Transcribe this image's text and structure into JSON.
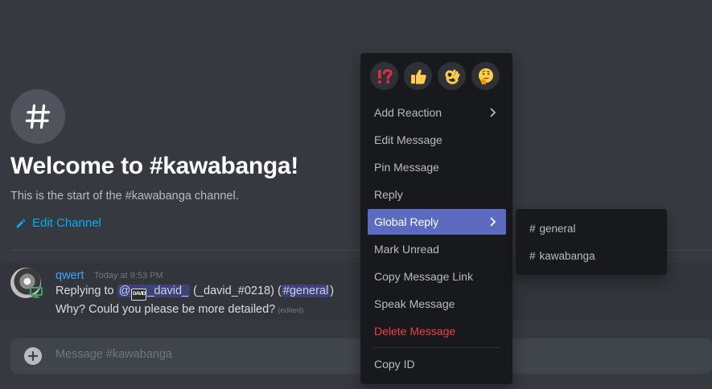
{
  "channel_header": {
    "welcome_title": "Welcome to #kawabanga!",
    "welcome_subtitle": "This is the start of the #kawabanga channel.",
    "edit_channel_label": "Edit Channel"
  },
  "message": {
    "author": "qwert",
    "timestamp": "Today at 9:53 PM",
    "reply_prefix": "Replying to",
    "reply_mention_at": "@",
    "reply_mention_badge": "DAVID",
    "reply_mention_name": "_david_",
    "reply_tag": "(_david_#0218)",
    "reply_channel": "#general",
    "text": "Why? Could you please be more detailed?",
    "edited_label": "(edited)",
    "avatar_status_icon": "desktop-icon"
  },
  "composer": {
    "placeholder": "Message #kawabanga"
  },
  "context_menu": {
    "reactions": [
      {
        "name": "exclamation-question-emoji",
        "glyph": "⁉"
      },
      {
        "name": "thumbs-up-emoji",
        "glyph": "👍"
      },
      {
        "name": "ok-hand-emoji",
        "glyph": "👌"
      },
      {
        "name": "thinking-emoji",
        "glyph": "🤔"
      }
    ],
    "items": [
      {
        "label": "Add Reaction",
        "submenu": true
      },
      {
        "label": "Edit Message"
      },
      {
        "label": "Pin Message"
      },
      {
        "label": "Reply"
      },
      {
        "label": "Global Reply",
        "submenu": true,
        "active": true
      },
      {
        "label": "Mark Unread"
      },
      {
        "label": "Copy Message Link"
      },
      {
        "label": "Speak Message"
      },
      {
        "label": "Delete Message",
        "danger": true
      },
      {
        "label": "Copy ID"
      }
    ]
  },
  "global_reply_submenu": {
    "items": [
      {
        "hash": "#",
        "label": "general"
      },
      {
        "hash": "#",
        "label": "kawabanga"
      }
    ]
  },
  "colors": {
    "background": "#36393f",
    "menu_background": "#18191c",
    "active_item": "#5c6bc0",
    "danger": "#ed4245",
    "link": "#00aff4",
    "author": "#3ba7ff"
  }
}
